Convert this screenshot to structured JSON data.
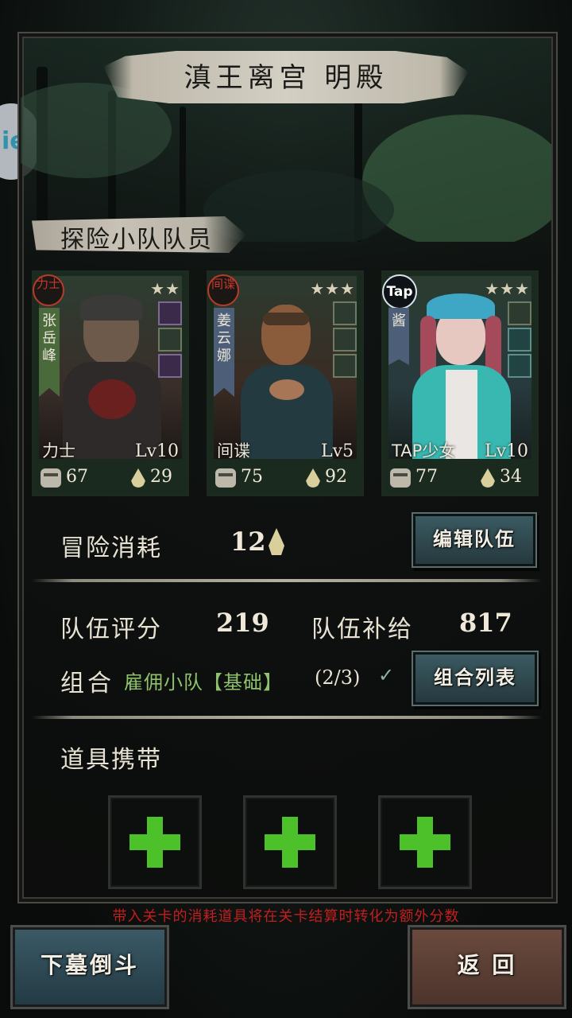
{
  "header": {
    "title": "滇王离宫  明殿",
    "side_badge": "ie"
  },
  "team_section": {
    "title": "探险小队队员"
  },
  "members": [
    {
      "badge": "力士",
      "badge_type": "seal",
      "name": "张岳峰",
      "ribbon_color": "green",
      "class": "力士",
      "level": "Lv10",
      "stars": "★★",
      "power": "67",
      "supply": "29"
    },
    {
      "badge": "间谍",
      "badge_type": "seal",
      "name": "姜云娜",
      "ribbon_color": "blue",
      "class": "间谍",
      "level": "Lv5",
      "stars": "★★★",
      "power": "75",
      "supply": "92"
    },
    {
      "badge": "Tap",
      "badge_type": "tap",
      "name": "酱",
      "ribbon_color": "blue",
      "class": "TAP少女",
      "level": "Lv10",
      "stars": "★★★",
      "power": "77",
      "supply": "34"
    }
  ],
  "adventure_cost": {
    "label": "冒险消耗",
    "value": "12"
  },
  "buttons": {
    "edit_team": "编辑队伍",
    "combo_list": "组合列表",
    "enter": "下墓倒斗",
    "back": "返 回"
  },
  "team_score": {
    "label": "队伍评分",
    "value": "219"
  },
  "team_supply": {
    "label": "队伍补给",
    "value": "817"
  },
  "combo": {
    "label": "组合",
    "name": "雇佣小队【基础】",
    "count": "(2/3)"
  },
  "items_section": {
    "title": "道具携带"
  },
  "note": "带入关卡的消耗道具将在关卡结算时转化为额外分数",
  "colors": {
    "accent_green": "#4cc12a",
    "warning_red": "#c21f1f",
    "combo_green": "#8ec26b"
  }
}
